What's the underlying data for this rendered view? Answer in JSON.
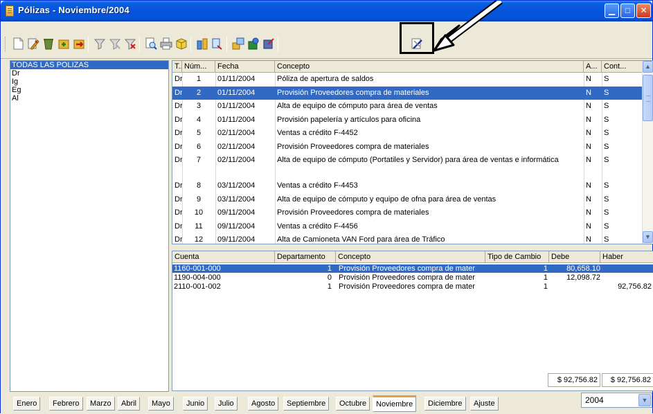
{
  "window": {
    "title": "Pólizas - Noviembre/2004"
  },
  "colors": {
    "selection": "#316ac5",
    "title_bar": "#0654da",
    "active_tab_accent": "#e89e3a"
  },
  "toolbar": {
    "buttons": [
      {
        "name": "new-icon"
      },
      {
        "name": "edit-icon"
      },
      {
        "name": "delete-icon"
      },
      {
        "name": "import-icon"
      },
      {
        "name": "export-icon"
      },
      {
        "name": "filter-icon"
      },
      {
        "name": "filter-clear-icon"
      },
      {
        "name": "filter-remove-icon"
      },
      {
        "name": "preview-icon"
      },
      {
        "name": "print-icon"
      },
      {
        "name": "report-icon"
      },
      {
        "name": "accounts-icon"
      },
      {
        "name": "search-icon"
      },
      {
        "name": "transfer-icon"
      },
      {
        "name": "users-icon"
      },
      {
        "name": "post-icon"
      },
      {
        "name": "tools-icon"
      }
    ]
  },
  "left_panel": {
    "items": [
      "TODAS LAS POLIZAS",
      "Dr",
      "Ig",
      "Eg",
      "Al"
    ],
    "selected": "TODAS LAS POLIZAS"
  },
  "grid": {
    "columns": [
      "T..",
      "Núm...",
      "Fecha",
      "Concepto",
      "A...",
      "Cont..."
    ],
    "rows": [
      {
        "t": "Dr",
        "num": "1",
        "fecha": "01/11/2004",
        "concepto": "Póliza de apertura de saldos",
        "a": "N",
        "cont": "S"
      },
      {
        "t": "Dr",
        "num": "2",
        "fecha": "01/11/2004",
        "concepto": "Provisión Proveedores compra de materiales",
        "a": "N",
        "cont": "S",
        "selected": true
      },
      {
        "t": "Dr",
        "num": "3",
        "fecha": "01/11/2004",
        "concepto": "Alta de equipo de cómputo para área de ventas",
        "a": "N",
        "cont": "S"
      },
      {
        "t": "Dr",
        "num": "4",
        "fecha": "01/11/2004",
        "concepto": "Provisión  papelería y artículos para oficina",
        "a": "N",
        "cont": "S"
      },
      {
        "t": "Dr",
        "num": "5",
        "fecha": "02/11/2004",
        "concepto": "Ventas a crédito F-4452",
        "a": "N",
        "cont": "S"
      },
      {
        "t": "Dr",
        "num": "6",
        "fecha": "02/11/2004",
        "concepto": "Provisión Proveedores compra de materiales",
        "a": "N",
        "cont": "S"
      },
      {
        "t": "Dr",
        "num": "7",
        "fecha": "02/11/2004",
        "concepto": "Alta de equipo de cómputo (Portatiles y Servidor) para área de ventas e informática",
        "a": "N",
        "cont": "S",
        "tall": true
      },
      {
        "t": "Dr",
        "num": "8",
        "fecha": "03/11/2004",
        "concepto": "Ventas a crédito F-4453",
        "a": "N",
        "cont": "S"
      },
      {
        "t": "Dr",
        "num": "9",
        "fecha": "03/11/2004",
        "concepto": "Alta de equipo de cómputo y equipo de ofna para área de ventas",
        "a": "N",
        "cont": "S"
      },
      {
        "t": "Dr",
        "num": "10",
        "fecha": "09/11/2004",
        "concepto": "Provisión Proveedores compra de materiales",
        "a": "N",
        "cont": "S"
      },
      {
        "t": "Dr",
        "num": "11",
        "fecha": "09/11/2004",
        "concepto": "Ventas a crédito F-4456",
        "a": "N",
        "cont": "S"
      },
      {
        "t": "Dr",
        "num": "12",
        "fecha": "09/11/2004",
        "concepto": "Alta de Camioneta VAN Ford para área de Tráfico",
        "a": "N",
        "cont": "S"
      }
    ]
  },
  "details": {
    "columns": [
      "Cuenta",
      "Departamento",
      "Concepto",
      "Tipo de Cambio",
      "Debe",
      "Haber"
    ],
    "rows": [
      {
        "cuenta": "1160-001-000",
        "depto": "1",
        "concepto": "Provisión Proveedores compra de mater",
        "tc": "1",
        "debe": "80,658.10",
        "haber": "",
        "selected": true
      },
      {
        "cuenta": "1190-004-000",
        "depto": "0",
        "concepto": "Provisión Proveedores compra de mater",
        "tc": "1",
        "debe": "12,098.72",
        "haber": ""
      },
      {
        "cuenta": "2110-001-002",
        "depto": "1",
        "concepto": "Provisión Proveedores compra de mater",
        "tc": "1",
        "debe": "",
        "haber": "92,756.82"
      }
    ],
    "totals": {
      "debe": "$ 92,756.82",
      "haber": "$ 92,756.82"
    }
  },
  "tabs": {
    "items": [
      "Enero",
      "Febrero",
      "Marzo",
      "Abril",
      "Mayo",
      "Junio",
      "Julio",
      "Agosto",
      "Septiembre",
      "Octubre",
      "Noviembre",
      "Diciembre",
      "Ajuste"
    ],
    "active": "Noviembre"
  },
  "year_select": {
    "value": "2004"
  }
}
